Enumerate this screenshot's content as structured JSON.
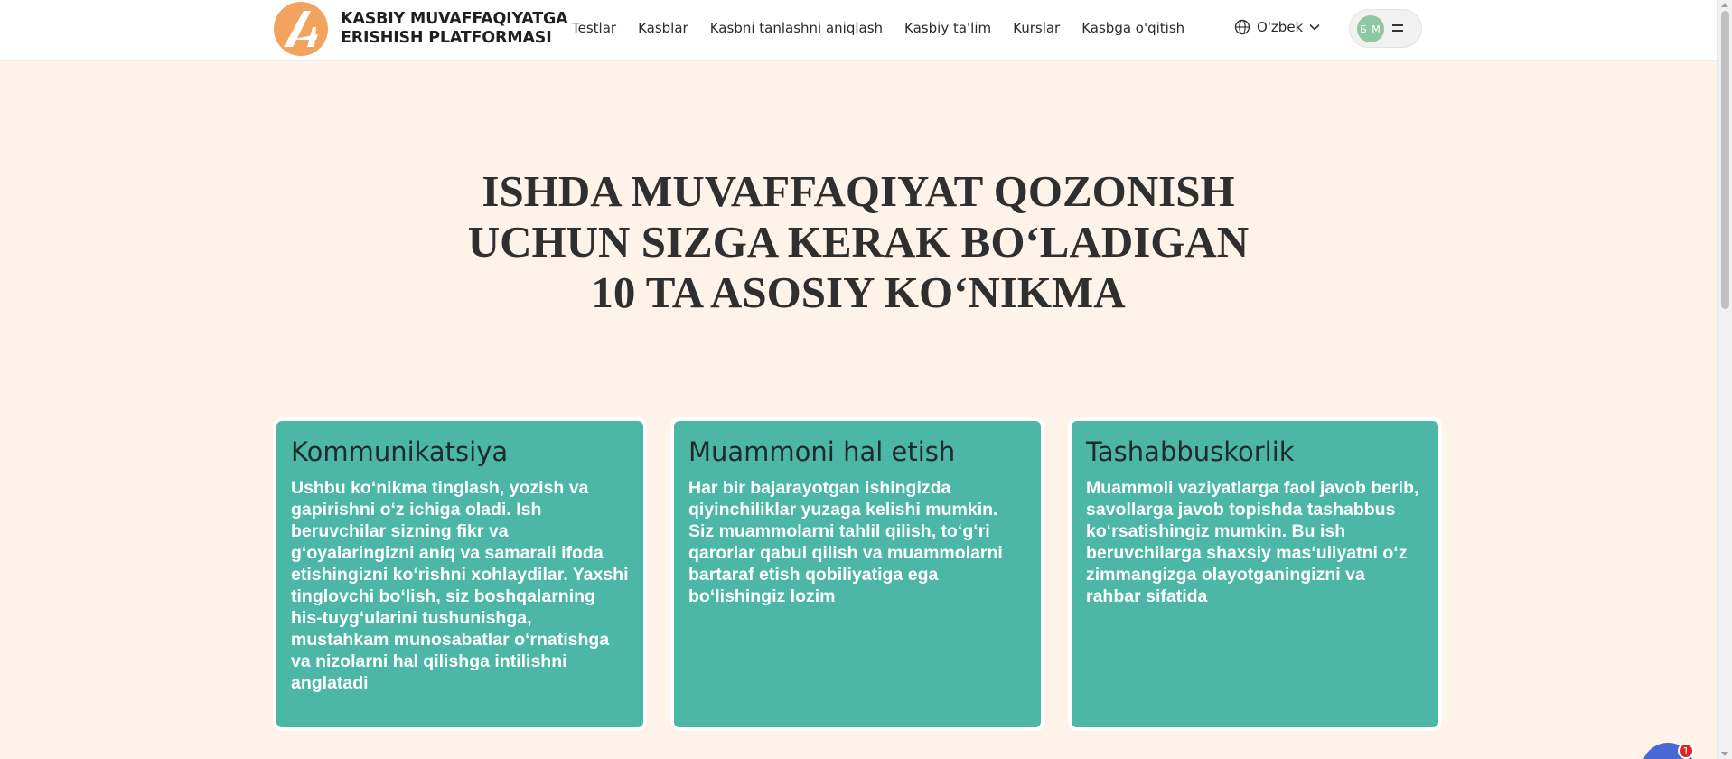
{
  "header": {
    "brand_line1": "KASBIY MUVAFFAQIYATGA",
    "brand_line2": "ERISHISH PLATFORMASI",
    "nav": [
      "Testlar",
      "Kasblar",
      "Kasbni tanlashni aniqlash",
      "Kasbiy ta'lim",
      "Kurslar",
      "Kasbga o'qitish"
    ],
    "language": "O'zbek",
    "avatar_initials": "Б М",
    "icons": {
      "logo": "logo-icon",
      "globe": "globe-icon",
      "chevron": "chevron-down-icon",
      "menu": "menu-icon"
    }
  },
  "hero": {
    "line1": "ISHDA MUVAFFAQIYAT QOZONISH",
    "line2": "UCHUN SIZGA KERAK BOʻLADIGAN",
    "line3": "10 TA ASOSIY KOʻNIKMA"
  },
  "cards": [
    {
      "title": "Kommunikatsiya",
      "text": "Ushbu koʻnikma tinglash, yozish va gapirishni oʻz ichiga oladi. Ish beruvchilar sizning fikr va gʻoyalaringizni aniq va samarali ifoda etishingizni koʻrishni xohlaydilar. Yaxshi tinglovchi boʻlish, siz boshqalarning his-tuygʻularini tushunishga, mustahkam munosabatlar oʻrnatishga va nizolarni hal qilishga intilishni anglatadi"
    },
    {
      "title": "Muammoni hal etish",
      "text": "Har bir bajarayotgan ishingizda qiyinchiliklar yuzaga kelishi mumkin. Siz muammolarni tahlil qilish, toʻgʻri qarorlar qabul qilish va muammolarni bartaraf etish qobiliyatiga ega boʻlishingiz lozim"
    },
    {
      "title": "Tashabbuskorlik",
      "text": "Muammoli vaziyatlarga faol javob berib, savollarga javob topishda tashabbus koʻrsatishingiz mumkin. Bu ish beruvchilarga shaxsiy masʻuliyatni oʻz zimmangizga olayotganingizni va rahbar sifatida"
    }
  ],
  "chat": {
    "badge": "1"
  },
  "colors": {
    "background": "#fdf3e8",
    "card": "#4cb7a7",
    "logo": "#f2a35e"
  }
}
